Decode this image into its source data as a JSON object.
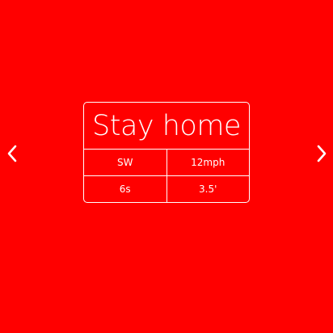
{
  "colors": {
    "background": "#ff0000",
    "foreground": "#ffffff"
  },
  "card": {
    "title": "Stay home",
    "rows": [
      {
        "left": "SW",
        "right": "12mph"
      },
      {
        "left": "6s",
        "right": "3.5'"
      }
    ]
  },
  "navigation": {
    "prev_icon": "chevron-left-icon",
    "next_icon": "chevron-right-icon"
  }
}
